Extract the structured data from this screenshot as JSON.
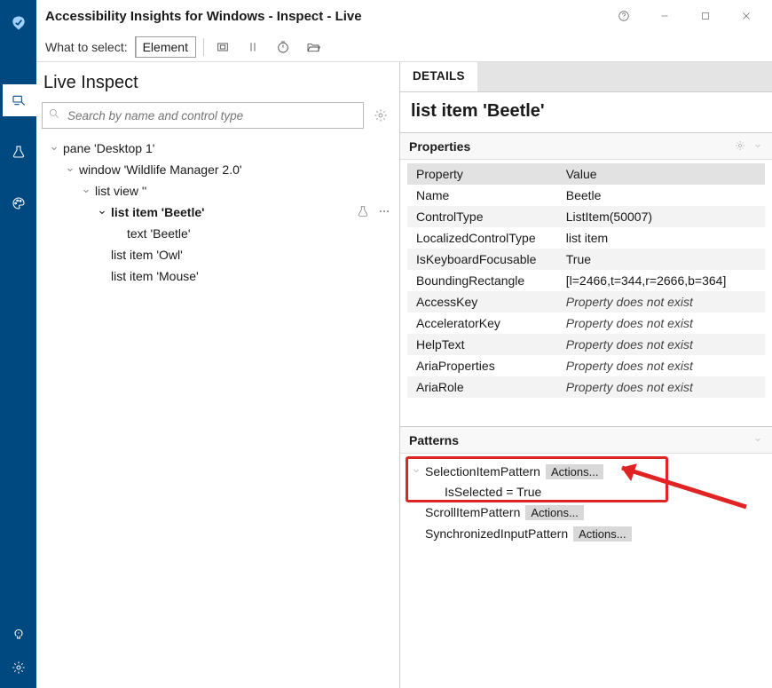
{
  "window": {
    "title": "Accessibility Insights for Windows - Inspect - Live"
  },
  "toolbar": {
    "select_label": "What to select:",
    "select_value": "Element"
  },
  "leftnav": {
    "items": [
      "inspect",
      "test",
      "color-contrast"
    ],
    "bottom": [
      "link",
      "settings"
    ]
  },
  "tree": {
    "heading": "Live Inspect",
    "search_placeholder": "Search by name and control type",
    "nodes": {
      "n0": "pane 'Desktop 1'",
      "n1": "window 'Wildlife Manager 2.0'",
      "n2": "list view ''",
      "n3": "list item 'Beetle'",
      "n4": "text 'Beetle'",
      "n5": "list item 'Owl'",
      "n6": "list item 'Mouse'"
    }
  },
  "details": {
    "tab": "DETAILS",
    "heading": "list item 'Beetle'",
    "properties_title": "Properties",
    "headers": {
      "k": "Property",
      "v": "Value"
    },
    "rows": [
      {
        "k": "Name",
        "v": "Beetle"
      },
      {
        "k": "ControlType",
        "v": "ListItem(50007)"
      },
      {
        "k": "LocalizedControlType",
        "v": "list item"
      },
      {
        "k": "IsKeyboardFocusable",
        "v": "True"
      },
      {
        "k": "BoundingRectangle",
        "v": "[l=2466,t=344,r=2666,b=364]"
      },
      {
        "k": "AccessKey",
        "v": "Property does not exist",
        "ne": true
      },
      {
        "k": "AcceleratorKey",
        "v": "Property does not exist",
        "ne": true
      },
      {
        "k": "HelpText",
        "v": "Property does not exist",
        "ne": true
      },
      {
        "k": "AriaProperties",
        "v": "Property does not exist",
        "ne": true
      },
      {
        "k": "AriaRole",
        "v": "Property does not exist",
        "ne": true
      }
    ],
    "patterns_title": "Patterns",
    "patterns": {
      "p0": {
        "name": "SelectionItemPattern",
        "actions": "Actions..."
      },
      "p0_sub": "IsSelected = True",
      "p1": {
        "name": "ScrollItemPattern",
        "actions": "Actions..."
      },
      "p2": {
        "name": "SynchronizedInputPattern",
        "actions": "Actions..."
      }
    }
  }
}
